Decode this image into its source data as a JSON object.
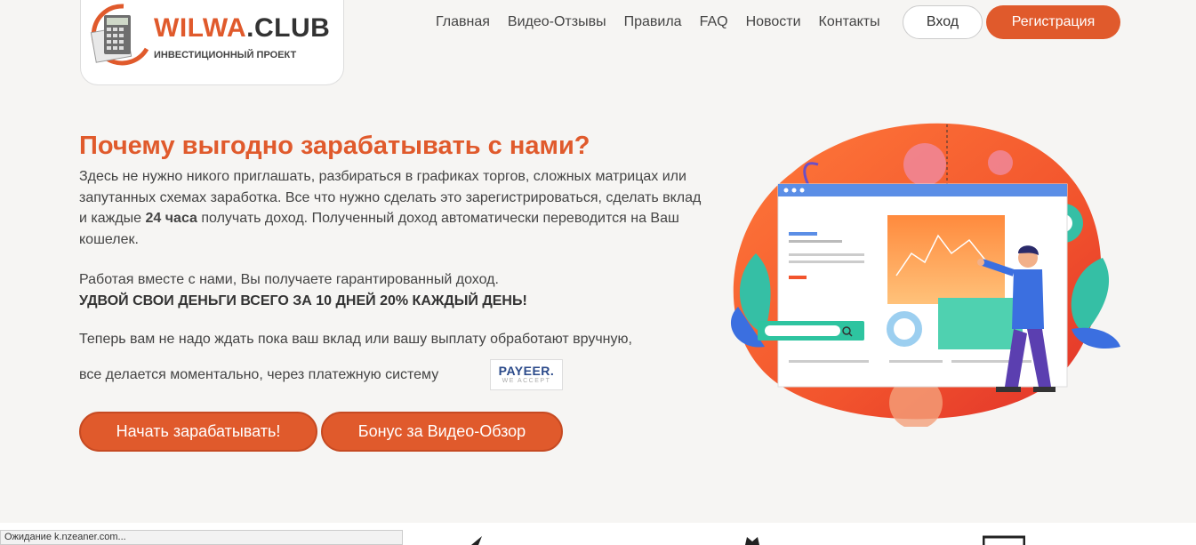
{
  "header": {
    "logo_title_accent": "WILWA",
    "logo_title_rest": ".CLUB",
    "logo_subtitle": "ИНВЕСТИЦИОННЫЙ ПРОЕКТ",
    "nav": [
      "Главная",
      "Видео-Отзывы",
      "Правила",
      "FAQ",
      "Новости",
      "Контакты"
    ],
    "login_label": "Вход",
    "register_label": "Регистрация"
  },
  "hero": {
    "title": "Почему выгодно зарабатывать с нами?",
    "text_before_bold": "Здесь не нужно никого приглашать, разбираться в графиках торгов, сложных матрицах или запутанных схемах заработка. Все что нужно сделать это зарегистрироваться, сделать вклад и каждые ",
    "text_bold": "24 часа",
    "text_after_bold": " получать доход. Полученный доход автоматически переводится на Ваш кошелек.",
    "p2_line1": "Работая вместе с нами, Вы получаете гарантированный доход.",
    "p2_line2": "УДВОЙ СВОИ ДЕНЬГИ ВСЕГО ЗА 10 ДНЕЙ 20% КАЖДЫЙ ДЕНЬ!",
    "p3_line1": "Теперь вам не надо ждать пока ваш вклад или вашу выплату обработают вручную,",
    "p3_line2": "все делается моментально, через платежную систему",
    "payeer_main": "PAYEER.",
    "payeer_sub": "WE ACCEPT",
    "cta_primary": "Начать зарабатывать!",
    "cta_secondary": "Бонус за Видео-Обзор"
  },
  "statusbar": {
    "text": "Ожидание k.nzeaner.com..."
  },
  "colors": {
    "accent": "#e05a2c",
    "background": "#f6f5f3"
  },
  "icons": [
    "calculator-logo-icon",
    "search-icon",
    "user-figure-illustration"
  ]
}
